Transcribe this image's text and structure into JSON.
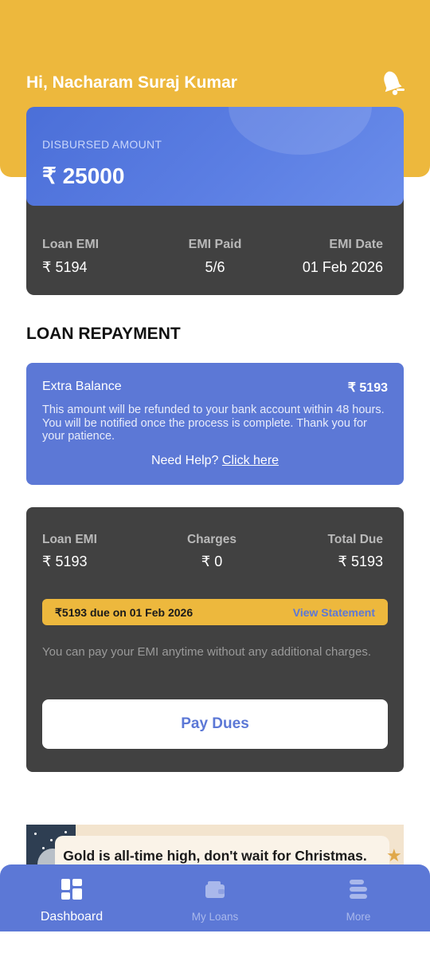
{
  "header": {
    "greeting": "Hi, Nacharam Suraj Kumar",
    "bell_icon": "bell-icon",
    "bg_color": "#EDB83D"
  },
  "disbursed": {
    "label": "DISBURSED AMOUNT",
    "amount": "₹ 25000"
  },
  "emi_summary": {
    "loan_emi_label": "Loan EMI",
    "loan_emi_value": "₹ 5194",
    "emi_paid_label": "EMI Paid",
    "emi_paid_value": "5/6",
    "emi_date_label": "EMI Date",
    "emi_date_value": "01 Feb 2026"
  },
  "repayment": {
    "title": "LOAN REPAYMENT",
    "extra_balance": {
      "title": "Extra Balance",
      "amount": "₹ 5193",
      "message": "This amount will be refunded to your bank account within 48 hours. You will be notified once the process is complete. Thank you for your patience.",
      "help_prefix": "Need Help?",
      "help_link": "Click here"
    },
    "dues": {
      "loan_emi_label": "Loan EMI",
      "loan_emi_value": "₹ 5193",
      "charges_label": "Charges",
      "charges_value": "₹ 0",
      "total_due_label": "Total Due",
      "total_due_value": "₹ 5193",
      "due_notice": "₹5193 due on 01 Feb 2026",
      "view_statement": "View Statement",
      "note": "You can pay your EMI anytime without any additional charges.",
      "pay_button": "Pay Dues"
    }
  },
  "promo": {
    "text": "Gold is all-time high, don't wait for Christmas."
  },
  "bottom_nav": {
    "items": [
      {
        "label": "Dashboard",
        "icon": "dashboard-icon",
        "active": true
      },
      {
        "label": "My Loans",
        "icon": "wallet-icon",
        "active": false
      },
      {
        "label": "More",
        "icon": "menu-icon",
        "active": false
      }
    ],
    "bg_color": "#5C78D6"
  },
  "colors": {
    "accent_yellow": "#EDB83D",
    "accent_blue": "#5C78D6",
    "card_dark": "#414141"
  }
}
